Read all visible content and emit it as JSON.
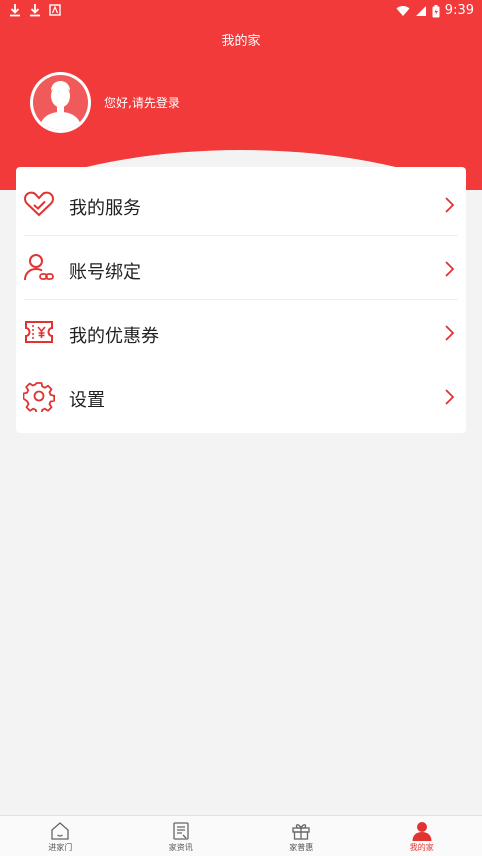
{
  "status_bar": {
    "time": "9:39"
  },
  "header": {
    "title": "我的家",
    "login_prompt": "您好,请先登录"
  },
  "menu": {
    "items": [
      {
        "label": "我的服务",
        "icon": "heart-tag-icon"
      },
      {
        "label": "账号绑定",
        "icon": "user-link-icon"
      },
      {
        "label": "我的优惠券",
        "icon": "coupon-icon"
      },
      {
        "label": "设置",
        "icon": "gear-icon"
      }
    ]
  },
  "bottom_nav": {
    "items": [
      {
        "label": "进家门",
        "icon": "home-icon"
      },
      {
        "label": "家资讯",
        "icon": "news-icon"
      },
      {
        "label": "家普惠",
        "icon": "gift-icon"
      },
      {
        "label": "我的家",
        "icon": "profile-icon",
        "active": true
      }
    ]
  },
  "colors": {
    "brand_red": "#f23a3b",
    "background": "#f3f3f3"
  }
}
